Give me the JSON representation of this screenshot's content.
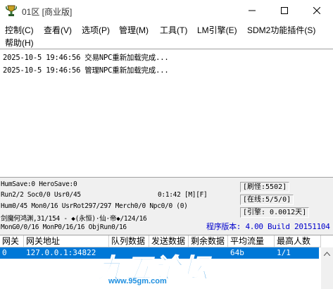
{
  "window": {
    "title": "01区 [商业版]",
    "icon": "trophy-app-icon"
  },
  "menu": [
    {
      "label": "控制(C)"
    },
    {
      "label": "查看(V)"
    },
    {
      "label": "选项(P)"
    },
    {
      "label": "管理(M)"
    },
    {
      "label": "工具(T)"
    },
    {
      "label": "LM引擎(E)"
    },
    {
      "label": "SDM2功能插件(S)"
    },
    {
      "label": "帮助(H)"
    }
  ],
  "log": [
    "2025-10-5 19:46:56 交易NPC重新加载完成...",
    "2025-10-5 19:46:56 管理NPC重新加载完成..."
  ],
  "status": {
    "line1": "HumSave:0 HeroSave:0",
    "line2": "Run2/2 Soc0/0 Usr0/45",
    "timer": "0:1:42 [M][F]",
    "line3": "Hum0/45 Mon0/16 UsrRot297/297 Merch0/0 Npc0/0 (0)",
    "line4": "剑魔何鸿渊,31/154 - ◆(永恒)·仙·帝◆/124/16",
    "line5": "MonG0/0/16 MonP0/16/16 ObjRun0/16",
    "refresh": "[刷怪:5502]",
    "online": "[在线:5/5/0]",
    "engine": "[引擎: 0.0012天]",
    "version": "程序版本: 4.00 Build 20151104"
  },
  "gate_table": {
    "columns": [
      "网关",
      "网关地址",
      "队列数据",
      "发送数据",
      "剩余数据",
      "平均流量",
      "最高人数"
    ],
    "rows": [
      [
        "0",
        "127.0.0.1:34822",
        "",
        "",
        "",
        "64b",
        "1/1"
      ]
    ]
  },
  "watermark": {
    "text": "九五论坛",
    "url": "www.95gm.com"
  },
  "colors": {
    "selection": "#0078d7",
    "version_text": "#0000cc",
    "watermark": "#1e8fe0"
  }
}
